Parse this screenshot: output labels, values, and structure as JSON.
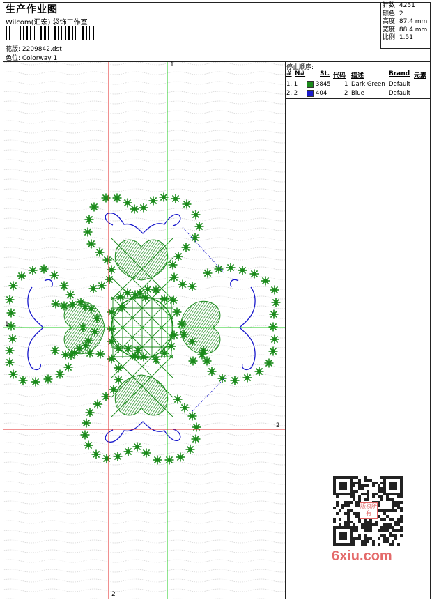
{
  "header": {
    "title": "生产作业图",
    "company": "Wilcom(汇宏) 袋饰工作室",
    "design_label": "花版: 2209842.dst",
    "colorway_label": "色位: Colorway 1"
  },
  "stats": {
    "stitches": "针数: 4251",
    "colors": "颜色: 2",
    "height": "高度: 87.4 mm",
    "width": "宽度: 88.4 mm",
    "scale": "比例: 1.51"
  },
  "stop_sequence": {
    "title": "停止顺序:",
    "headers": {
      "hash": "#",
      "n": "N#",
      "st": "St.",
      "code": "代码",
      "desc": "描述",
      "brand": "Brand",
      "element": "元素"
    },
    "rows": [
      {
        "index": "1. 1",
        "color": "#1a8a1a",
        "stitches": "3845",
        "code": "1",
        "description": "Dark Green",
        "brand": "Default"
      },
      {
        "index": "2. 2",
        "color": "#1a1acc",
        "stitches": "404",
        "code": "2",
        "description": "Blue",
        "brand": "Default"
      }
    ]
  },
  "guides": {
    "green_top": "1",
    "green_left": "1",
    "red_right": "2",
    "red_bottom": "2"
  },
  "colors": {
    "green_thread": "#1a8a1a",
    "blue_thread": "#1a1acc",
    "guide_green": "#22cc22",
    "guide_red": "#e02020"
  },
  "watermark": {
    "text": "6xiu.com",
    "stamp": "版权所有"
  }
}
